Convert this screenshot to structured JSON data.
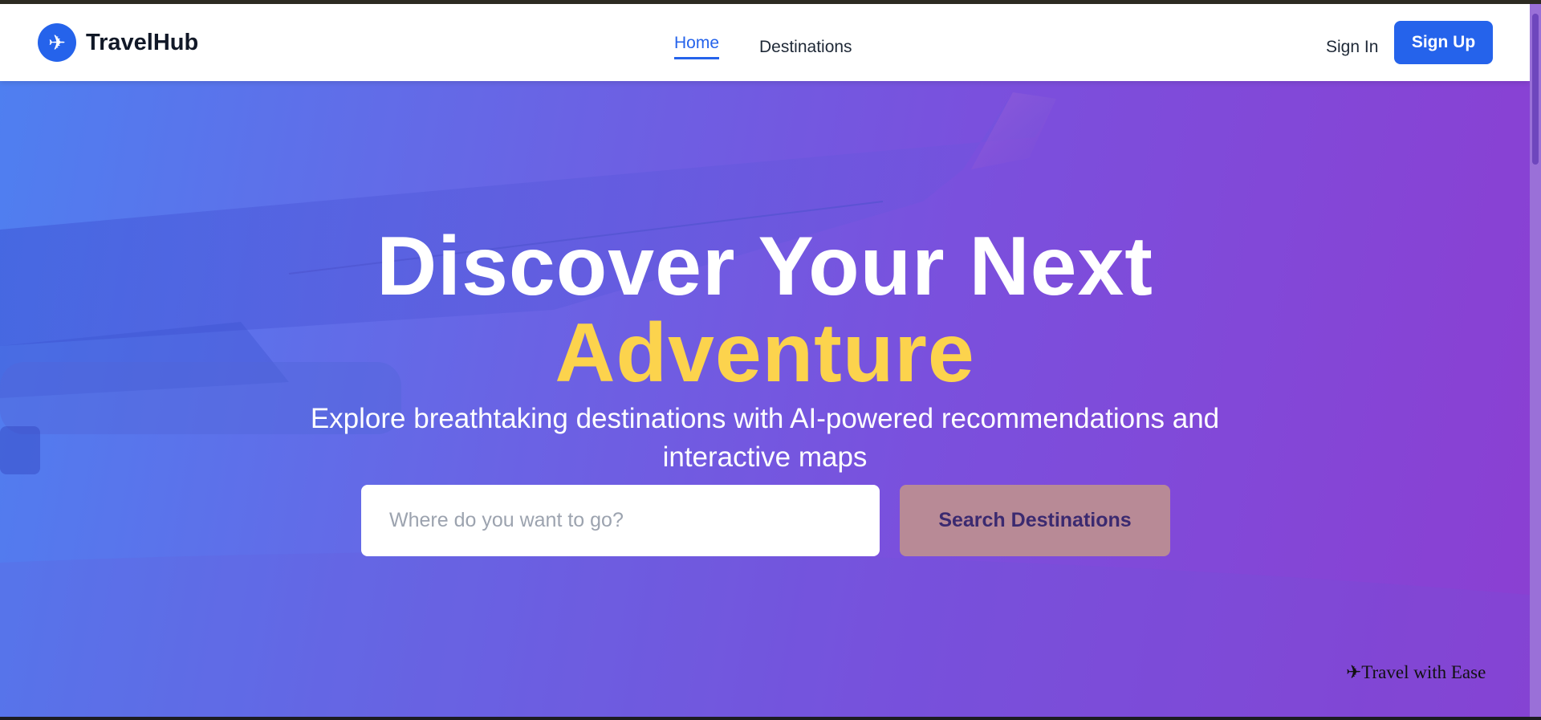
{
  "header": {
    "logo_icon": "airplane-icon",
    "logo_text": "TravelHub",
    "nav": [
      {
        "label": "Home",
        "active": true
      },
      {
        "label": "Destinations",
        "active": false
      }
    ],
    "signin_label": "Sign In",
    "signup_label": "Sign Up"
  },
  "hero": {
    "title_line1": "Discover Your Next",
    "title_line2": "Adventure",
    "subtitle": "Explore breathtaking destinations with AI-powered recommendations and interactive maps",
    "search_placeholder": "Where do you want to go?",
    "search_value": "",
    "search_button_label": "Search Destinations",
    "tagline_icon": "airplane-icon",
    "tagline": "Travel with Ease"
  },
  "colors": {
    "brand": "#2563eb",
    "accent_text": "#fcd34d",
    "hero_gradient_start": "#4f7ff0",
    "hero_gradient_end": "#8b3fd2",
    "search_button": "#b88a96"
  }
}
